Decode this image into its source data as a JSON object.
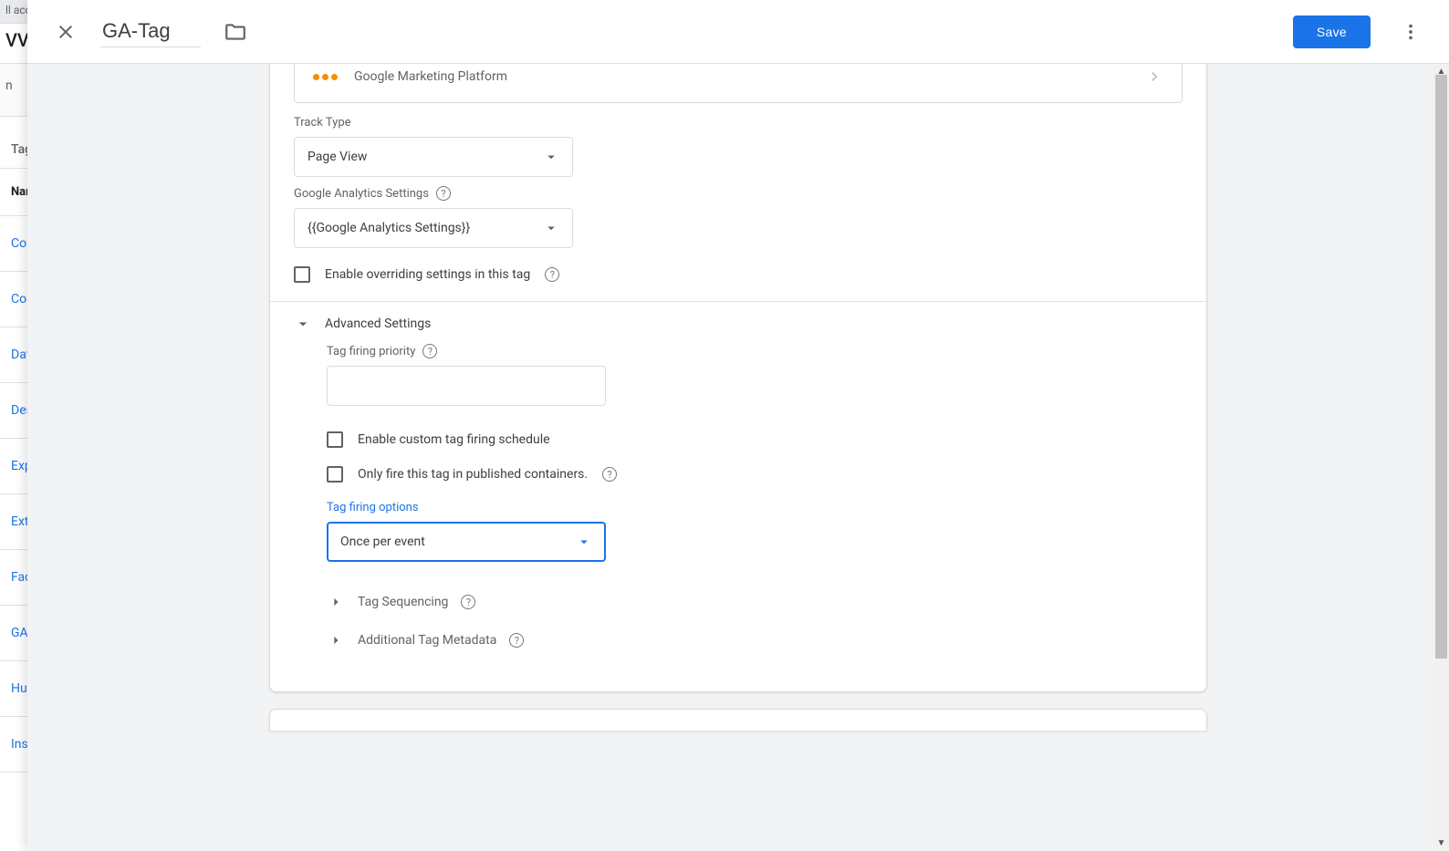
{
  "header": {
    "title_value": "GA-Tag",
    "save_label": "Save"
  },
  "platform_box": {
    "name": "Google Marketing Platform"
  },
  "track_type": {
    "label": "Track Type",
    "value": "Page View"
  },
  "ga_settings": {
    "label": "Google Analytics Settings",
    "value": "{{Google Analytics Settings}}"
  },
  "override_checkbox": {
    "label": "Enable overriding settings in this tag"
  },
  "advanced": {
    "header": "Advanced Settings",
    "priority_label": "Tag firing priority",
    "priority_value": "",
    "custom_schedule_label": "Enable custom tag firing schedule",
    "published_only_label": "Only fire this tag in published containers.",
    "firing_options_label": "Tag firing options",
    "firing_options_value": "Once per event",
    "tag_sequencing_label": "Tag Sequencing",
    "additional_meta_label": "Additional Tag Metadata"
  },
  "bg": {
    "accounts": "ll acc",
    "brand": "VV",
    "toolbar": "n",
    "tabs_label": "Tag",
    "name_col": "Nar",
    "items": [
      "Cor",
      "Cor",
      "Dat",
      "Des",
      "Exp",
      "Ext",
      "Fac",
      "GA-",
      "Hut",
      "Ins"
    ]
  }
}
